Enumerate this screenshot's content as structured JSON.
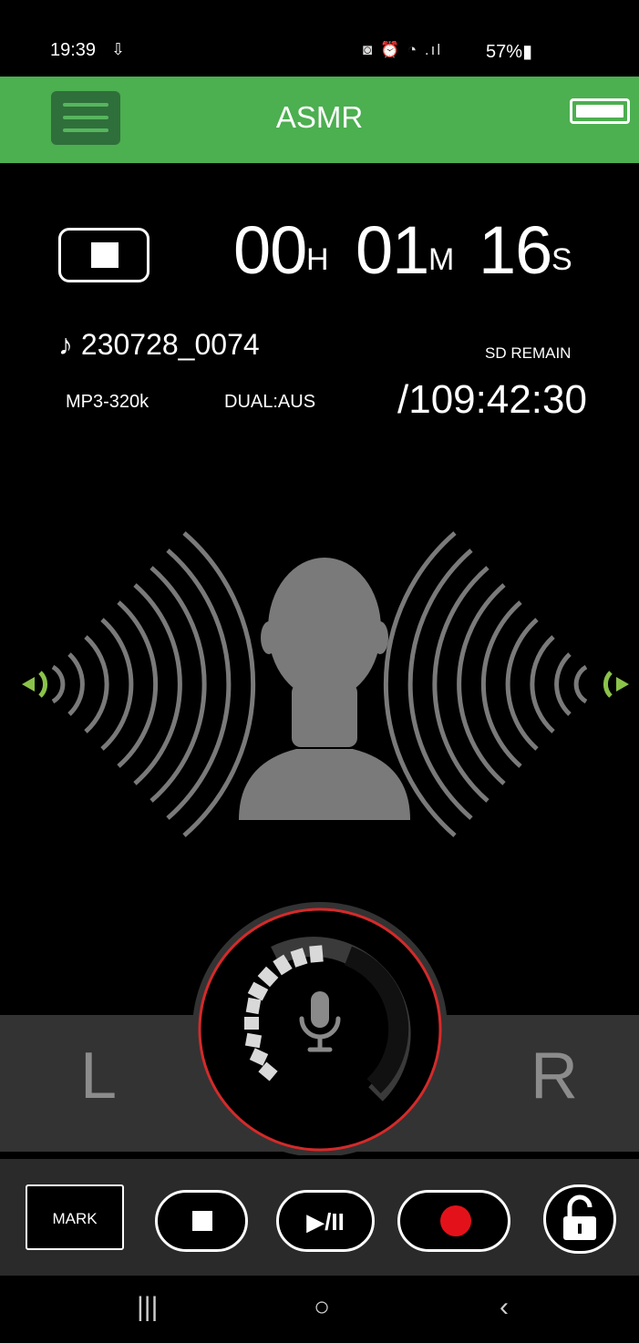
{
  "status_bar": {
    "time": "19:39",
    "download_icon": "⇩",
    "icons": "◙ ⏰ ◔ .ıl",
    "battery_text": "57%▮"
  },
  "header": {
    "title": "ASMR",
    "menu_icon": "hamburger-menu-icon",
    "battery_icon": "battery-icon",
    "color": "#4caf50"
  },
  "counter": {
    "hours": "00",
    "hours_unit": "H",
    "minutes": "01",
    "minutes_unit": "M",
    "seconds": "16",
    "seconds_unit": "S"
  },
  "file": {
    "name": "♪ 230728_0074",
    "format": "MP3-320k",
    "channel_mode": "DUAL:AUS",
    "sd_label": "SD REMAIN",
    "sd_remain": "/109:42:30"
  },
  "meter": {
    "left_label": "L",
    "right_label": "R",
    "level_segments_lit": 10,
    "level_segments_total": 10,
    "ring_color": "#d42a2a",
    "wave_accent_color": "#8bc34a"
  },
  "transport": {
    "mark_label": "MARK",
    "play_pause_label": "▶/II",
    "stop_icon": "stop-icon",
    "record_icon": "record-icon",
    "lock_icon": "unlocked-padlock-icon",
    "record_color": "#e3121a"
  },
  "navbar": {
    "recents": "|||",
    "home": "○",
    "back": "‹"
  }
}
